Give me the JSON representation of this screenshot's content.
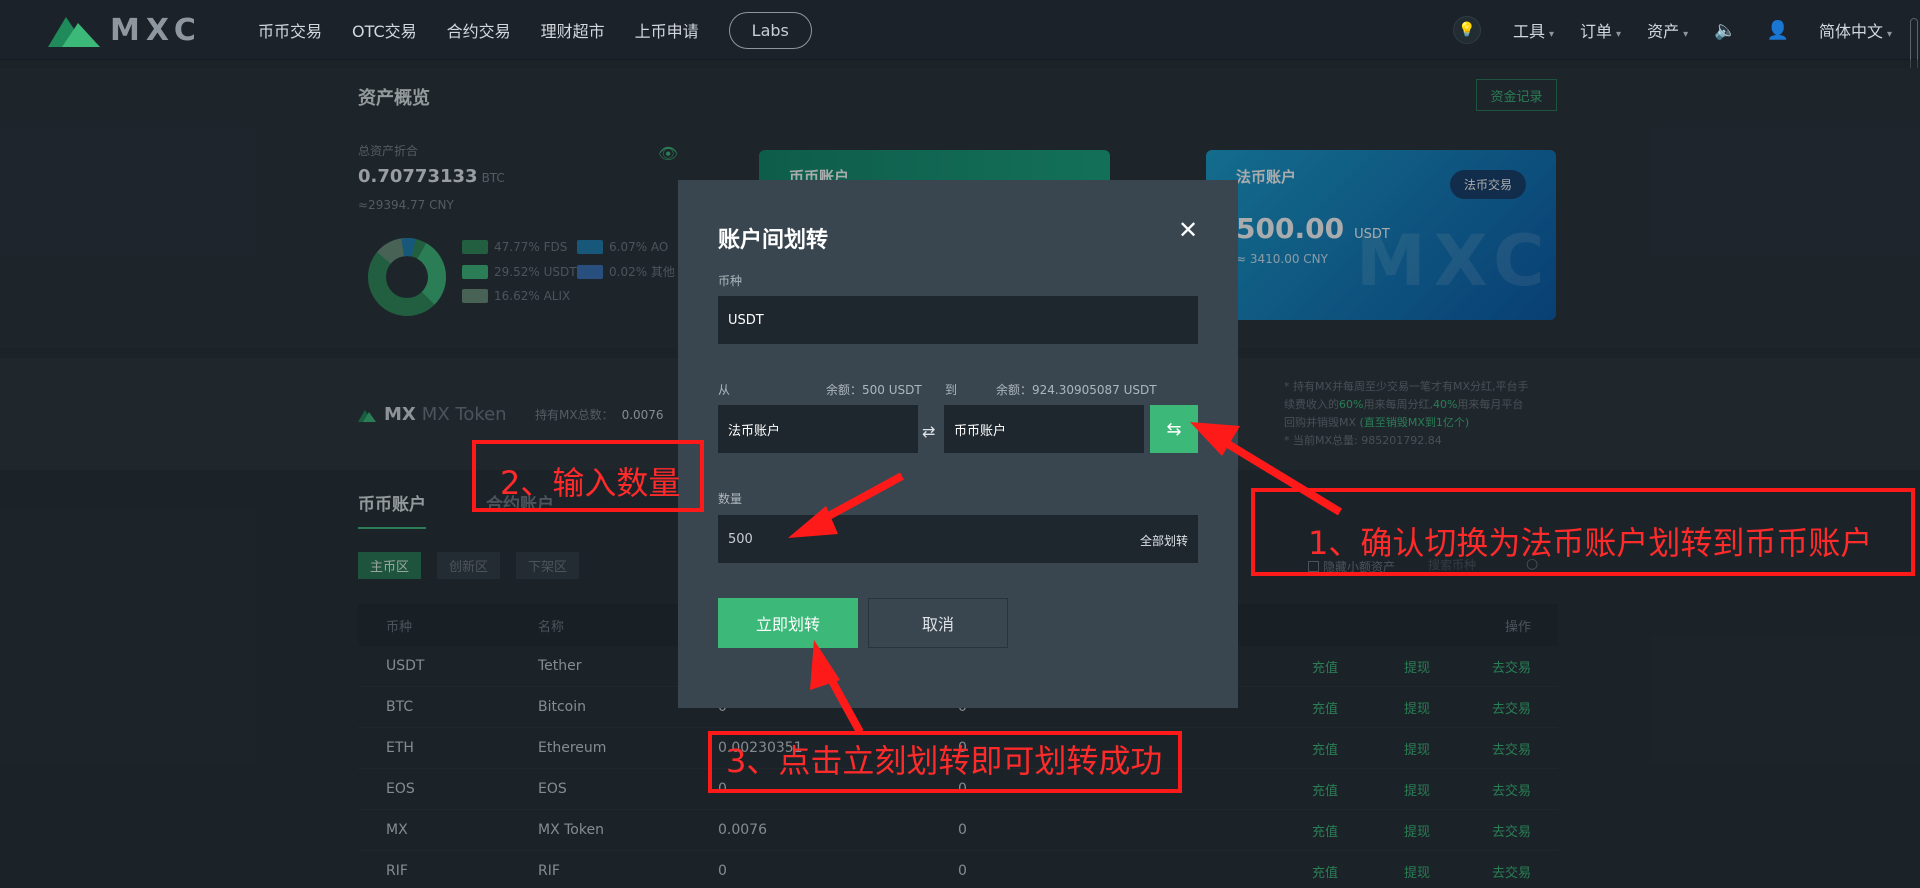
{
  "header": {
    "logo_text": "MXC",
    "nav": [
      "币币交易",
      "OTC交易",
      "合约交易",
      "理财超市",
      "上币申请"
    ],
    "labs": "Labs",
    "menus": [
      "工具",
      "订单",
      "资产"
    ],
    "language": "简体中文"
  },
  "overview": {
    "title": "资产概览",
    "fund_record_button": "资金记录",
    "total_label": "总资产折合",
    "total_btc": "0.70773133",
    "total_btc_unit": "BTC",
    "total_cny": "≈29394.77 CNY",
    "legend": [
      {
        "label": "47.77% FDS",
        "color": "#2e8a5a"
      },
      {
        "label": "6.07% AO",
        "color": "#1f7fb3"
      },
      {
        "label": "29.52% USDT",
        "color": "#3cb878"
      },
      {
        "label": "0.02% 其他",
        "color": "#3a72b8"
      },
      {
        "label": "16.62% ALIX",
        "color": "#6a8f7a"
      }
    ]
  },
  "cards": {
    "coin_account_title": "币币账户",
    "fiat_account_title": "法币账户",
    "fiat_trade_button": "法币交易",
    "fiat_amount": "500.00",
    "fiat_unit": "USDT",
    "fiat_cny": "≈ 3410.00 CNY",
    "watermark": "MXC"
  },
  "mx": {
    "name": "MX",
    "subname": "MX Token",
    "hold_label": "持有MX总数：",
    "hold_value": "0.0076",
    "note_line1": "* 持有MX并每周至少交易一笔才有MX分红,平台手",
    "note_line2_a": "续费收入的",
    "note_line2_b": "60%",
    "note_line2_c": "用来每周分红,",
    "note_line2_d": "40%",
    "note_line2_e": "用来每月平台",
    "note_line3_a": "回购并销毁MX",
    "note_line3_b": "(直至销毁MX到1亿个)",
    "note_line4": "* 当前MX总量: 985201792.84"
  },
  "accounts": {
    "tabs": [
      "币币账户",
      "合约账户"
    ],
    "zones": [
      "主币区",
      "创新区",
      "下架区"
    ],
    "hide_small_label": "隐藏小额资产",
    "search_placeholder": "搜索币种",
    "columns": [
      "币种",
      "名称",
      "",
      "",
      "操作"
    ],
    "actions": [
      "充值",
      "提现",
      "去交易"
    ],
    "rows": [
      {
        "coin": "USDT",
        "name": "Tether",
        "available": "",
        "frozen": ""
      },
      {
        "coin": "BTC",
        "name": "Bitcoin",
        "available": "0",
        "frozen": "0"
      },
      {
        "coin": "ETH",
        "name": "Ethereum",
        "available": "0.00230351",
        "frozen": "0"
      },
      {
        "coin": "EOS",
        "name": "EOS",
        "available": "0",
        "frozen": "0"
      },
      {
        "coin": "MX",
        "name": "MX Token",
        "available": "0.0076",
        "frozen": "0"
      },
      {
        "coin": "RIF",
        "name": "RIF",
        "available": "0",
        "frozen": "0"
      }
    ]
  },
  "modal": {
    "title": "账户间划转",
    "coin_label": "币种",
    "coin_value": "USDT",
    "from_label": "从",
    "from_balance": "余额：500 USDT",
    "to_label": "到",
    "to_balance": "余额：924.30905087 USDT",
    "from_account": "法币账户",
    "to_account": "币币账户",
    "amount_label": "数量",
    "amount_value": "500",
    "all_transfer": "全部划转",
    "confirm_button": "立即划转",
    "cancel_button": "取消"
  },
  "annotations": {
    "step1": "1、确认切换为法币账户划转到币币账户",
    "step2": "2、输入数量",
    "step3": "3、点击立刻划转即可划转成功",
    "color": "#ff1a1a"
  }
}
